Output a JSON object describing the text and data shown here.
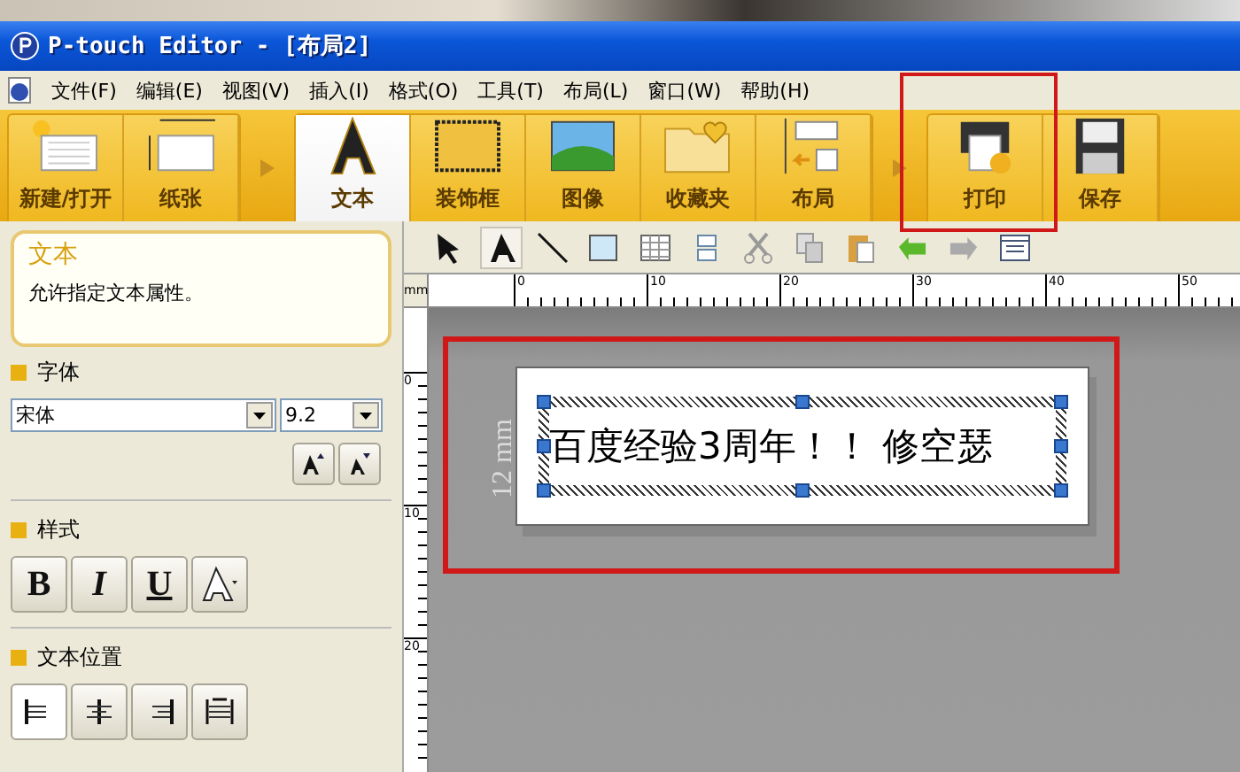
{
  "window": {
    "title": "P-touch Editor - [布局2]"
  },
  "menu": [
    "文件(F)",
    "编辑(E)",
    "视图(V)",
    "插入(I)",
    "格式(O)",
    "工具(T)",
    "布局(L)",
    "窗口(W)",
    "帮助(H)"
  ],
  "ribbon": {
    "groups": [
      {
        "items": [
          {
            "kind": "new",
            "label": "新建/打开",
            "selected": false
          },
          {
            "kind": "paper",
            "label": "纸张",
            "selected": false
          }
        ]
      },
      {
        "items": [
          {
            "kind": "text",
            "label": "文本",
            "selected": true
          },
          {
            "kind": "frame",
            "label": "装饰框",
            "selected": false
          },
          {
            "kind": "image",
            "label": "图像",
            "selected": false
          },
          {
            "kind": "favorites",
            "label": "收藏夹",
            "selected": false
          },
          {
            "kind": "layout",
            "label": "布局",
            "selected": false
          }
        ]
      },
      {
        "items": [
          {
            "kind": "print",
            "label": "打印",
            "selected": false
          },
          {
            "kind": "save",
            "label": "保存",
            "selected": false
          }
        ]
      }
    ]
  },
  "annotations": [
    {
      "kind": "frame"
    },
    {
      "kind": "frame"
    }
  ],
  "panel": {
    "title": "文本",
    "description": "允许指定文本属性。",
    "font_section": {
      "heading": "字体",
      "font": "宋体",
      "size": "9.2"
    },
    "style_section": {
      "heading": "样式",
      "buttons": [
        {
          "kind": "bold",
          "label": "B"
        },
        {
          "kind": "italic",
          "label": "I"
        },
        {
          "kind": "underline",
          "label": "U"
        },
        {
          "kind": "outline"
        }
      ]
    },
    "position_section": {
      "heading": "文本位置",
      "buttons": [
        {
          "kind": "left",
          "selected": true
        },
        {
          "kind": "center",
          "selected": false
        },
        {
          "kind": "right",
          "selected": false
        },
        {
          "kind": "justify",
          "selected": false
        }
      ]
    }
  },
  "toolbar": {
    "tools": [
      {
        "kind": "pointer",
        "selected": false
      },
      {
        "kind": "text",
        "selected": true
      },
      {
        "kind": "line",
        "selected": false
      },
      {
        "kind": "shape",
        "selected": false
      },
      {
        "kind": "table",
        "selected": false
      },
      {
        "kind": "arrange",
        "selected": false
      },
      {
        "kind": "cut",
        "selected": false
      },
      {
        "kind": "copy",
        "selected": false
      },
      {
        "kind": "paste",
        "selected": false
      },
      {
        "kind": "undo",
        "selected": false
      },
      {
        "kind": "redo",
        "selected": false
      },
      {
        "kind": "properties",
        "selected": false
      }
    ]
  },
  "ruler": {
    "unit": "mm",
    "marks": [
      "0",
      "10",
      "20",
      "30",
      "40",
      "50"
    ],
    "vertical_marks": [
      "0",
      "10",
      "20"
    ]
  },
  "label": {
    "tape_width": "12 mm",
    "text": "百度经验3周年！！ 修空瑟"
  }
}
